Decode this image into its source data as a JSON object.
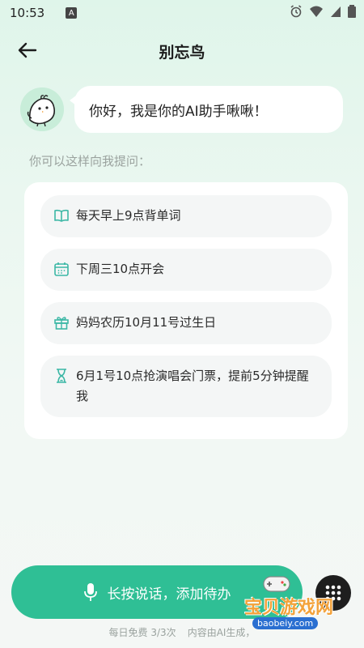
{
  "status_bar": {
    "time": "10:53",
    "notification_letter": "A",
    "icons": [
      "alarm-icon",
      "wifi-icon",
      "signal-icon",
      "battery-icon"
    ]
  },
  "app_bar": {
    "title": "别忘鸟",
    "back_icon": "arrow-left-icon"
  },
  "assistant": {
    "greeting": "你好，我是你的AI助手啾啾！",
    "avatar_icon": "bird-avatar-icon"
  },
  "hint": "你可以这样向我提问：",
  "suggestions": [
    {
      "icon": "book-icon",
      "text": "每天早上9点背单词"
    },
    {
      "icon": "calendar-icon",
      "text": "下周三10点开会"
    },
    {
      "icon": "gift-icon",
      "text": "妈妈农历10月11号过生日"
    },
    {
      "icon": "hourglass-icon",
      "text": "6月1号10点抢演唱会门票，提前5分钟提醒我"
    }
  ],
  "voice_button": {
    "label": "长按说话，添加待办",
    "icon": "microphone-icon"
  },
  "grid_button_icon": "grid-dots-icon",
  "footer": {
    "quota": "每日免费 3/3次",
    "disclaimer": "内容由AI生成，"
  },
  "watermark": {
    "text": "宝贝游戏网",
    "url": "baobeiy.com"
  },
  "colors": {
    "accent": "#2fbf95",
    "icon_teal": "#3bb7a5",
    "background_top": "#dff5ea"
  }
}
